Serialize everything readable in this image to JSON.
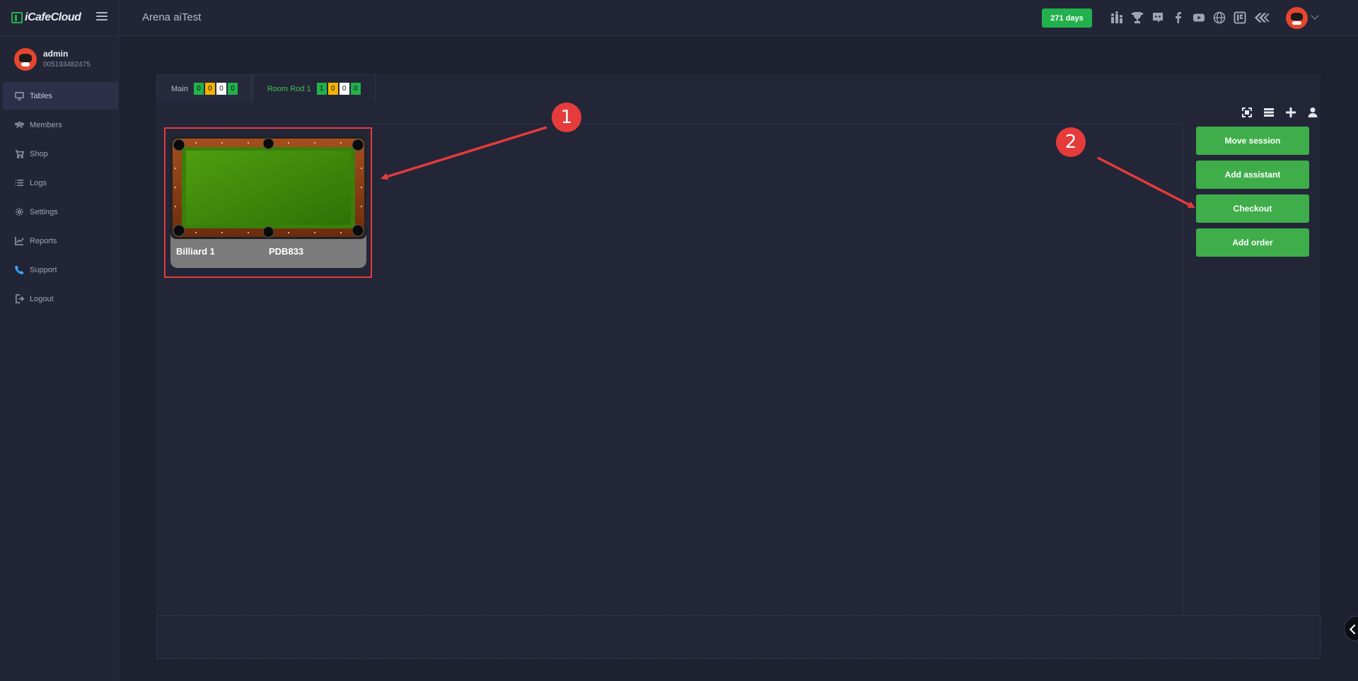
{
  "app": {
    "logo_text": "iCafeCloud",
    "workspace_title": "Arena aiTest",
    "days_badge": "271 days"
  },
  "top_icons": [
    "ranking-icon",
    "trophy-icon",
    "discord-icon",
    "facebook-icon",
    "youtube-icon",
    "globe-icon",
    "icafe-icon",
    "brand-icon"
  ],
  "user": {
    "name": "admin",
    "id": "005193482475"
  },
  "sidebar": {
    "items": [
      {
        "label": "Tables",
        "icon": "monitor-icon",
        "active": true
      },
      {
        "label": "Members",
        "icon": "users-icon"
      },
      {
        "label": "Shop",
        "icon": "cart-icon"
      },
      {
        "label": "Logs",
        "icon": "list-icon"
      },
      {
        "label": "Settings",
        "icon": "gear-icon"
      },
      {
        "label": "Reports",
        "icon": "chart-icon"
      },
      {
        "label": "Support",
        "icon": "phone-icon"
      },
      {
        "label": "Logout",
        "icon": "logout-icon"
      }
    ]
  },
  "tabs": [
    {
      "label": "Main",
      "counters": [
        "0",
        "0",
        "0",
        "0"
      ]
    },
    {
      "label": "Room Rod 1",
      "counters": [
        "1",
        "0",
        "0",
        "0"
      ],
      "active": true
    }
  ],
  "toolbar": [
    "fit-icon",
    "list-view-icon",
    "add-icon",
    "user-icon"
  ],
  "table": {
    "name": "Billiard 1",
    "code": "PDB833"
  },
  "actions": {
    "move_session": "Move session",
    "add_assistant": "Add assistant",
    "checkout": "Checkout",
    "add_order": "Add order"
  },
  "annotations": {
    "marker_1": "1",
    "marker_2": "2"
  },
  "colors": {
    "accent_green": "#22b14c",
    "button_green": "#3fae4a",
    "annotation_red": "#e53b3b",
    "counter_yellow": "#f5b400"
  }
}
